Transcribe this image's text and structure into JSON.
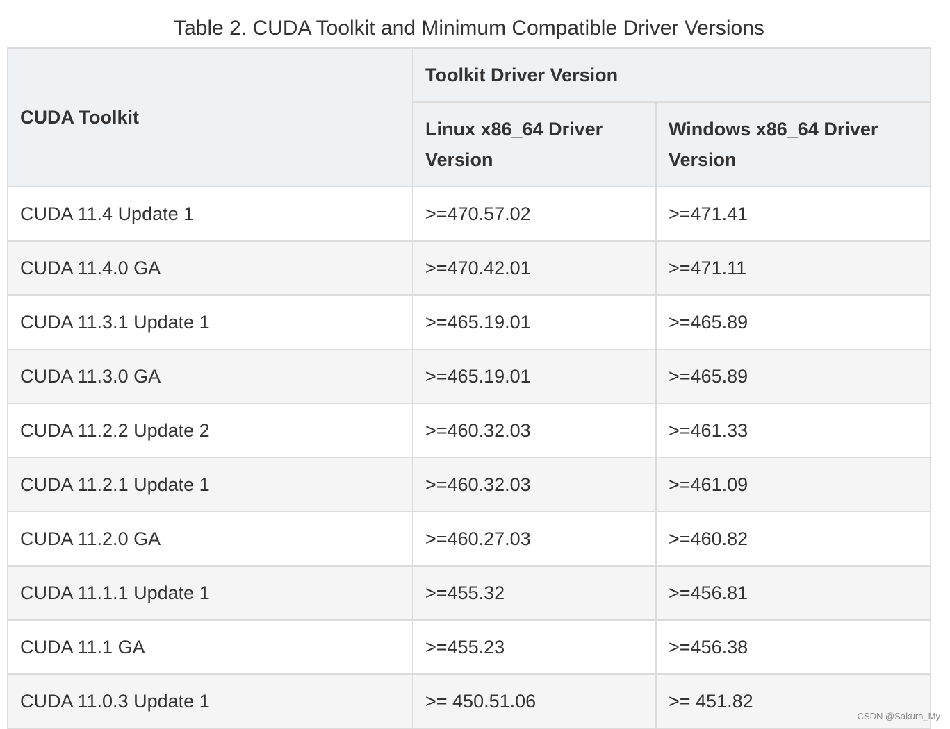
{
  "caption": "Table 2. CUDA Toolkit and Minimum Compatible Driver Versions",
  "header": {
    "cuda_toolkit": "CUDA Toolkit",
    "toolkit_driver_version": "Toolkit Driver Version",
    "linux_line1": "Linux x86_64 Driver",
    "linux_line2": "Version",
    "windows_line1": "Windows x86_64 Driver",
    "windows_line2": "Version"
  },
  "rows": [
    {
      "toolkit": "CUDA 11.4 Update 1",
      "linux": ">=470.57.02",
      "windows": ">=471.41"
    },
    {
      "toolkit": "CUDA 11.4.0 GA",
      "linux": ">=470.42.01",
      "windows": ">=471.11"
    },
    {
      "toolkit": "CUDA 11.3.1 Update 1",
      "linux": ">=465.19.01",
      "windows": ">=465.89"
    },
    {
      "toolkit": "CUDA 11.3.0 GA",
      "linux": ">=465.19.01",
      "windows": ">=465.89"
    },
    {
      "toolkit": "CUDA 11.2.2 Update 2",
      "linux": ">=460.32.03",
      "windows": ">=461.33"
    },
    {
      "toolkit": "CUDA 11.2.1 Update 1",
      "linux": ">=460.32.03",
      "windows": ">=461.09"
    },
    {
      "toolkit": "CUDA 11.2.0 GA",
      "linux": ">=460.27.03",
      "windows": ">=460.82"
    },
    {
      "toolkit": "CUDA 11.1.1 Update 1",
      "linux": ">=455.32",
      "windows": ">=456.81"
    },
    {
      "toolkit": "CUDA 11.1 GA",
      "linux": ">=455.23",
      "windows": ">=456.38"
    },
    {
      "toolkit": "CUDA 11.0.3 Update 1",
      "linux": ">= 450.51.06",
      "windows": ">= 451.82"
    }
  ],
  "watermark": "CSDN @Sakura_My",
  "colors": {
    "header_bg": "#eef2f5",
    "stripe_bg": "#f5f5f5",
    "border": "#dcdcdc",
    "text": "#333333"
  }
}
